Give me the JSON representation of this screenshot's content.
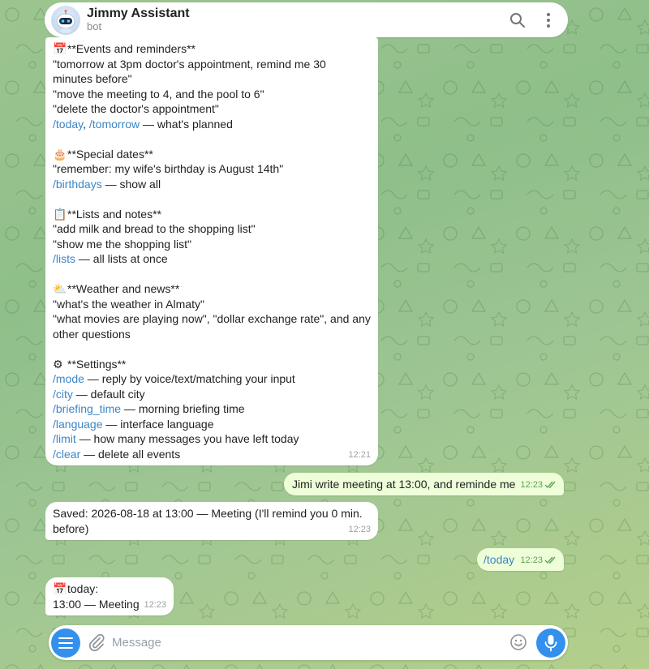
{
  "header": {
    "title": "Jimmy Assistant",
    "subtitle": "bot"
  },
  "help_message": {
    "events": {
      "heading": "**Events and reminders**",
      "example1": "\"tomorrow at 3pm doctor's appointment, remind me 30",
      "example1b": "minutes before\"",
      "example2": "\"move the meeting to 4, and the pool to 6\"",
      "example3": "\"delete the doctor's appointment\"",
      "cmd_today": "/today",
      "sep": ", ",
      "cmd_tomorrow": "/tomorrow",
      "cmd_desc": " — what's planned"
    },
    "dates": {
      "heading": "**Special dates**",
      "example1": "\"remember: my wife's birthday is August 14th\"",
      "cmd": "/birthdays",
      "cmd_desc": " — show all"
    },
    "lists": {
      "heading": "**Lists and notes**",
      "example1": "\"add milk and bread to the shopping list\"",
      "example2": "\"show me the shopping list\"",
      "cmd": "/lists",
      "cmd_desc": " — all lists at once"
    },
    "weather": {
      "heading": "**Weather and news**",
      "example1": "\"what's the weather in Almaty\"",
      "example2": "\"what movies are playing now\", \"dollar exchange rate\", and any",
      "example2b": "other questions"
    },
    "settings": {
      "heading": "**Settings**",
      "items": [
        {
          "cmd": "/mode",
          "desc": " — reply by voice/text/matching your input"
        },
        {
          "cmd": "/city",
          "desc": " — default city"
        },
        {
          "cmd": "/briefing_time",
          "desc": " — morning briefing time"
        },
        {
          "cmd": "/language",
          "desc": " — interface language"
        },
        {
          "cmd": "/limit",
          "desc": " — how many messages you have left today"
        },
        {
          "cmd": "/clear",
          "desc": " — delete all events"
        }
      ]
    },
    "time": "12:21"
  },
  "out_message_1": {
    "text": "Jimi write meeting at 13:00, and reminde me",
    "time": "12:23"
  },
  "in_message_2": {
    "line1": "Saved: 2026-08-18 at 13:00 — Meeting (I'll remind you 0 min.",
    "line2": "before)",
    "time": "12:23"
  },
  "out_message_2": {
    "cmd": "/today",
    "time": "12:23"
  },
  "in_message_3": {
    "line1": "today:",
    "line2": "13:00 — Meeting",
    "time": "12:23"
  },
  "composer": {
    "placeholder": "Message"
  },
  "colors": {
    "accent": "#3390ec",
    "link": "#3d85c6",
    "outgoing_bubble": "#eefed9",
    "timestamp_out": "#5fa356"
  },
  "icons": {
    "search": "search-icon",
    "more": "more-vertical-icon",
    "menu": "menu-icon",
    "attach": "paperclip-icon",
    "emoji": "smiley-icon",
    "mic": "microphone-icon"
  }
}
